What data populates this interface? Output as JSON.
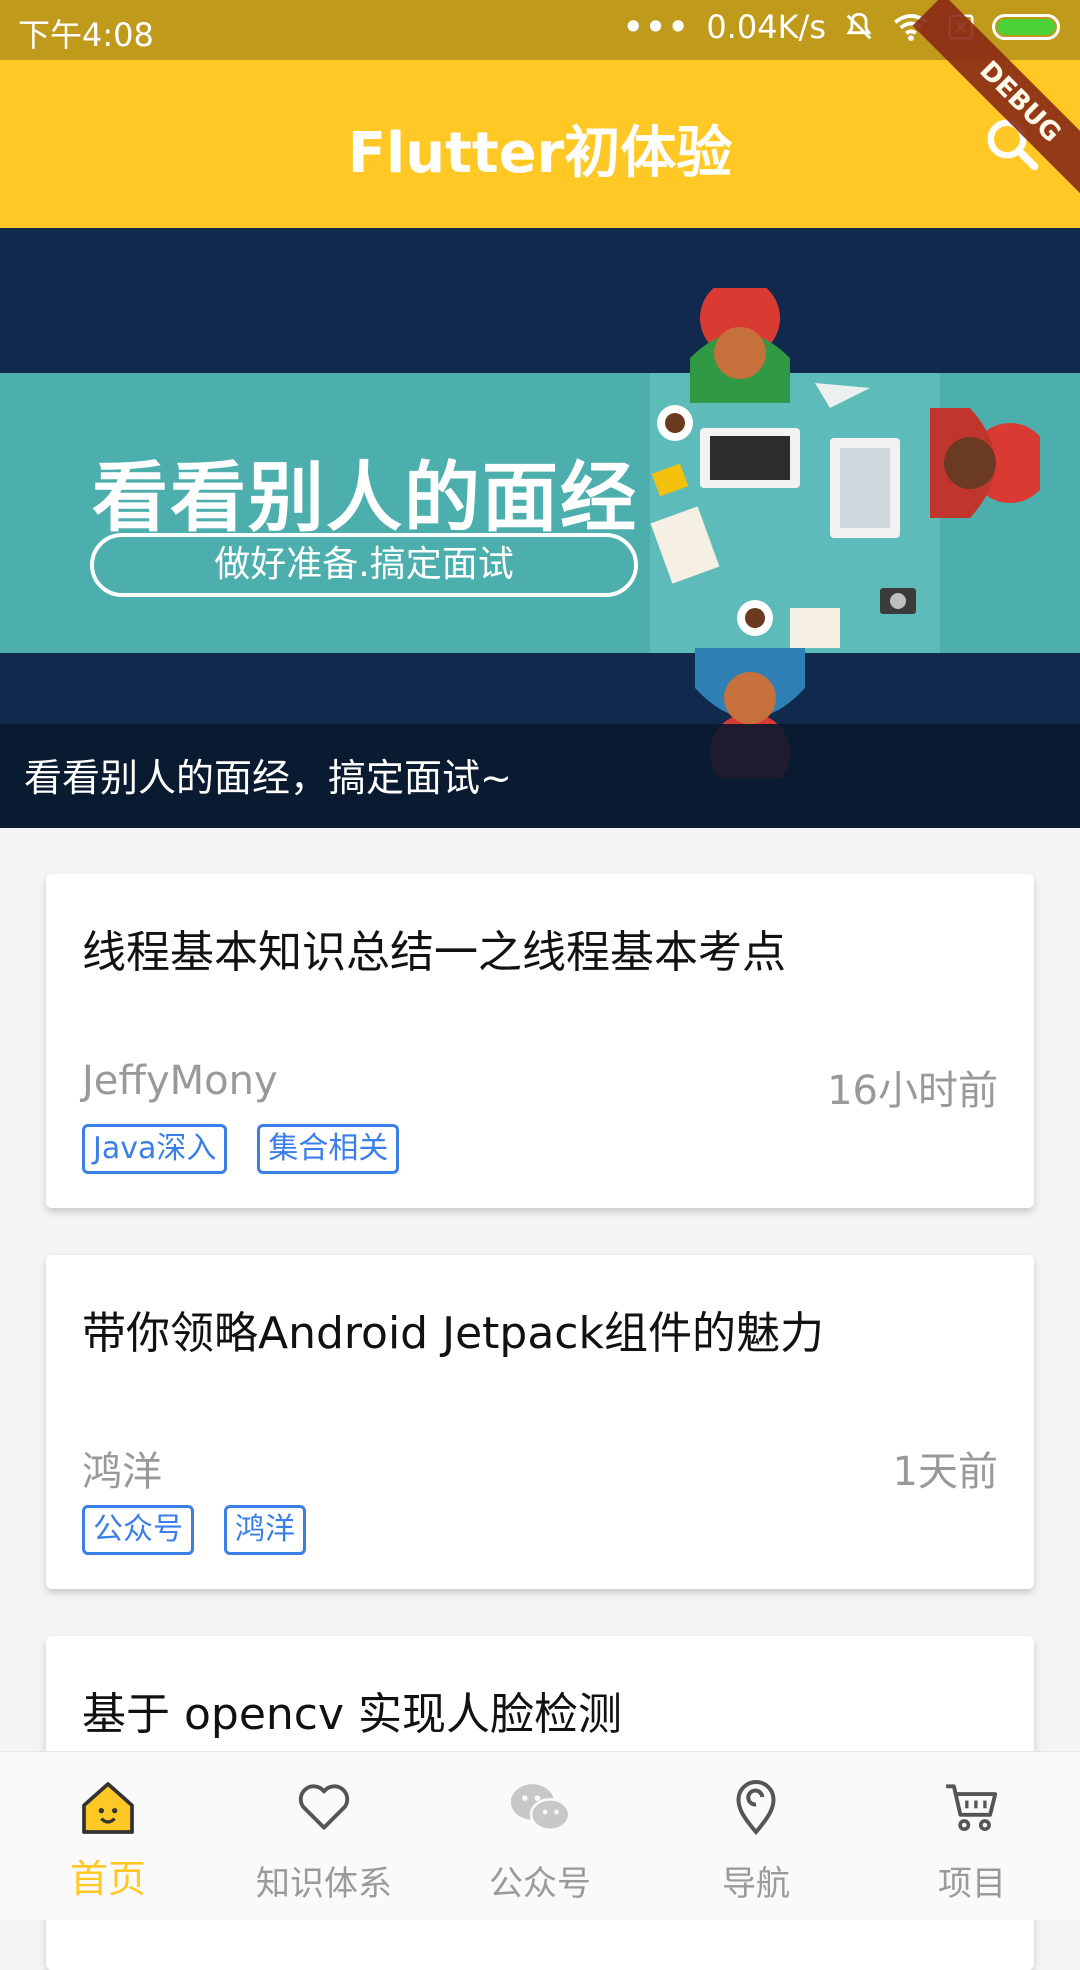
{
  "status_bar": {
    "time": "下午4:08",
    "network_speed": "0.04K/s",
    "dots": "•••"
  },
  "app_bar": {
    "title": "Flutter初体验",
    "debug_label": "DEBUG"
  },
  "banner": {
    "headline": "看看别人的面经",
    "subline": "做好准备.搞定面试",
    "caption": "看看别人的面经，搞定面试~"
  },
  "articles": [
    {
      "title": "线程基本知识总结一之线程基本考点",
      "author": "JeffyMony",
      "time": "16小时前",
      "tags": [
        "Java深入",
        "集合相关"
      ]
    },
    {
      "title": "带你领略Android Jetpack组件的魅力",
      "author": "鸿洋",
      "time": "1天前",
      "tags": [
        "公众号",
        "鸿洋"
      ]
    },
    {
      "title": "基于 opencv 实现人脸检测"
    }
  ],
  "bottom_nav": {
    "items": [
      {
        "label": "首页",
        "icon": "home-icon",
        "active": true
      },
      {
        "label": "知识体系",
        "icon": "heart-icon",
        "active": false
      },
      {
        "label": "公众号",
        "icon": "wechat-icon",
        "active": false
      },
      {
        "label": "导航",
        "icon": "location-pin-icon",
        "active": false
      },
      {
        "label": "项目",
        "icon": "cart-icon",
        "active": false
      }
    ]
  },
  "colors": {
    "app_bar": "#ffc824",
    "status_bar": "#c09a1b",
    "tag_blue": "#3a7ee8",
    "banner_navy": "#11294c",
    "banner_teal": "#4caead"
  }
}
